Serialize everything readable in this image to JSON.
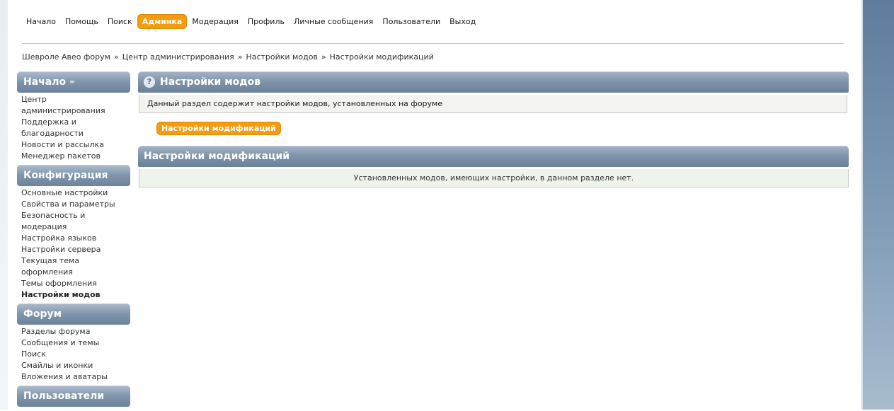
{
  "top_menu": [
    {
      "label": "Начало",
      "active": false
    },
    {
      "label": "Помощь",
      "active": false
    },
    {
      "label": "Поиск",
      "active": false
    },
    {
      "label": "Админка",
      "active": true
    },
    {
      "label": "Модерация",
      "active": false
    },
    {
      "label": "Профиль",
      "active": false
    },
    {
      "label": "Личные сообщения",
      "active": false
    },
    {
      "label": "Пользователи",
      "active": false
    },
    {
      "label": "Выход",
      "active": false
    }
  ],
  "breadcrumb": [
    "Шевроле Авео форум",
    "Центр администрирования",
    "Настройки модов",
    "Настройки модификаций"
  ],
  "breadcrumb_separator": "»",
  "sidebar": [
    {
      "title": "Начало",
      "arrows": "▸▸",
      "items": [
        {
          "label": "Центр администрирования",
          "active": false
        },
        {
          "label": "Поддержка и благодарности",
          "active": false
        },
        {
          "label": "Новости и рассылка",
          "active": false
        },
        {
          "label": "Менеджер пакетов",
          "active": false
        }
      ]
    },
    {
      "title": "Конфигурация",
      "items": [
        {
          "label": "Основные настройки",
          "active": false
        },
        {
          "label": "Свойства и параметры",
          "active": false
        },
        {
          "label": "Безопасность и модерация",
          "active": false
        },
        {
          "label": "Настройка языков",
          "active": false
        },
        {
          "label": "Настройки сервера",
          "active": false
        },
        {
          "label": "Текущая тема оформления",
          "active": false
        },
        {
          "label": "Темы оформления",
          "active": false
        },
        {
          "label": "Настройки модов",
          "active": true
        }
      ]
    },
    {
      "title": "Форум",
      "items": [
        {
          "label": "Разделы форума",
          "active": false
        },
        {
          "label": "Сообщения и темы",
          "active": false
        },
        {
          "label": "Поиск",
          "active": false
        },
        {
          "label": "Смайлы и иконки",
          "active": false
        },
        {
          "label": "Вложения и аватары",
          "active": false
        }
      ]
    },
    {
      "title": "Пользователи",
      "items": []
    }
  ],
  "main": {
    "section_title": "Настройки модов",
    "section_help_icon": "?",
    "section_description": "Данный раздел содержит настройки модов, установленных на форуме",
    "tab_label": "Настройки модификаций",
    "subsection_title": "Настройки модификаций",
    "empty_message": "Установленных модов, имеющих настройки, в данном разделе нет."
  },
  "colors": {
    "accent": "#f39c12",
    "header_bar": "#7d93aa"
  }
}
